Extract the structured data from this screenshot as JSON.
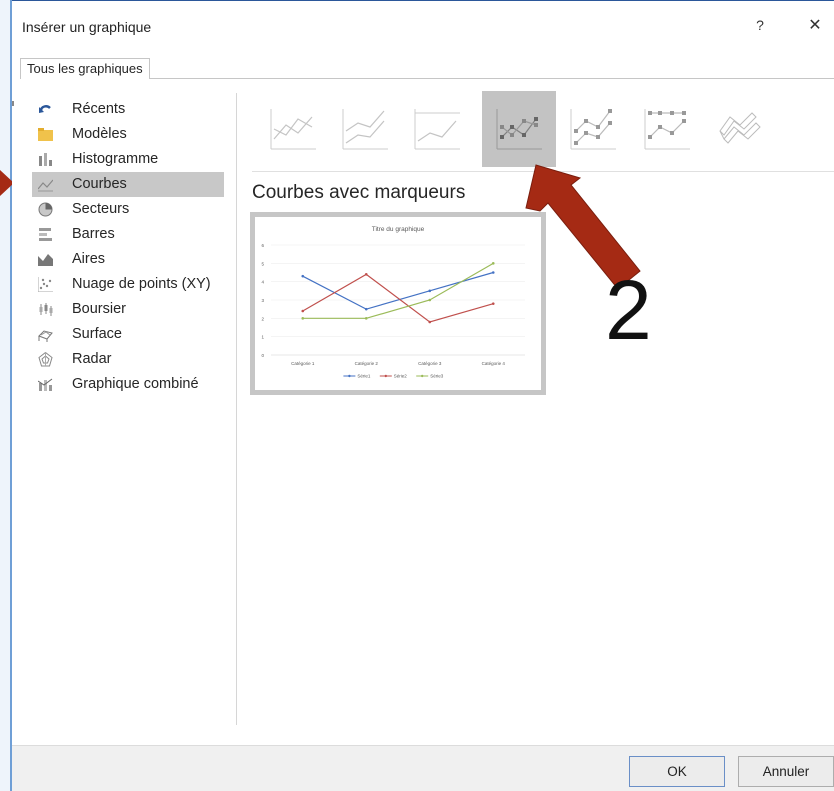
{
  "dialog": {
    "title": "Insérer un graphique",
    "help_label": "?",
    "close_label": "✕",
    "tab_label": "Tous les graphiques",
    "ok_label": "OK",
    "cancel_label": "Annuler"
  },
  "sidebar": {
    "items": [
      {
        "label": "Récents",
        "icon": "undo-arrow-icon"
      },
      {
        "label": "Modèles",
        "icon": "folder-icon"
      },
      {
        "label": "Histogramme",
        "icon": "column-chart-icon"
      },
      {
        "label": "Courbes",
        "icon": "line-chart-icon",
        "selected": true
      },
      {
        "label": "Secteurs",
        "icon": "pie-chart-icon"
      },
      {
        "label": "Barres",
        "icon": "bar-chart-icon"
      },
      {
        "label": "Aires",
        "icon": "area-chart-icon"
      },
      {
        "label": "Nuage de points (XY)",
        "icon": "scatter-chart-icon"
      },
      {
        "label": "Boursier",
        "icon": "stock-chart-icon"
      },
      {
        "label": "Surface",
        "icon": "surface-chart-icon"
      },
      {
        "label": "Radar",
        "icon": "radar-chart-icon"
      },
      {
        "label": "Graphique combiné",
        "icon": "combo-chart-icon"
      }
    ]
  },
  "subtypes": {
    "selected_index": 3,
    "icons": [
      "line-icon",
      "stacked-line-icon",
      "100-stacked-line-icon",
      "line-markers-icon",
      "stacked-line-markers-icon",
      "100-stacked-line-markers-icon",
      "3d-line-icon"
    ]
  },
  "section_title": "Courbes avec marqueurs",
  "annotation": {
    "number": "2",
    "color": "#a52a14"
  },
  "chart_data": {
    "type": "line",
    "title": "Titre du graphique",
    "categories": [
      "Catégorie 1",
      "Catégorie 2",
      "Catégorie 3",
      "Catégorie 4"
    ],
    "ylim": [
      0,
      6
    ],
    "yticks": [
      "0",
      "1",
      "2",
      "3",
      "4",
      "5",
      "6"
    ],
    "grid": true,
    "legend": "bottom",
    "series": [
      {
        "name": "Série1",
        "color": "#4472c4",
        "values": [
          4.3,
          2.5,
          3.5,
          4.5
        ]
      },
      {
        "name": "Série2",
        "color": "#c0504d",
        "values": [
          2.4,
          4.4,
          1.8,
          2.8
        ]
      },
      {
        "name": "Série3",
        "color": "#9bbb59",
        "values": [
          2,
          2,
          3,
          5
        ]
      }
    ]
  }
}
